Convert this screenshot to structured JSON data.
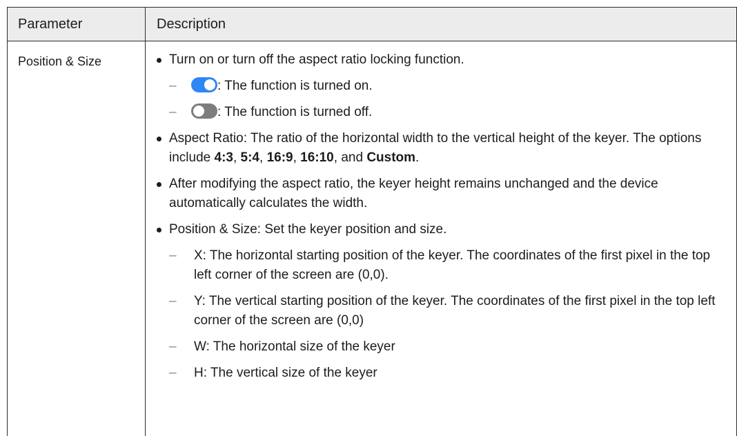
{
  "header": {
    "parameter": "Parameter",
    "description": "Description"
  },
  "row": {
    "parameter": "Position & Size",
    "bullet1": "Turn on or turn off the aspect ratio locking function.",
    "toggle_on_text": ": The function is turned on.",
    "toggle_off_text": ": The function is turned off.",
    "bullet2_prefix": "Aspect Ratio: The ratio of the horizontal width to the vertical height of the keyer. The options include ",
    "ratio_options": [
      "4:3",
      "5:4",
      "16:9",
      "16:10",
      "Custom"
    ],
    "sep_comma": ", ",
    "sep_and": ", and ",
    "period": ".",
    "bullet3": "After modifying the aspect ratio, the keyer height remains unchanged and the device automatically calculates the width.",
    "bullet4": "Position & Size: Set the keyer position and size.",
    "dash": "–",
    "sub_x": "X: The horizontal starting position of the keyer. The coordinates of the first pixel in the top left corner of the screen are (0,0).",
    "sub_y": "Y: The vertical starting position of the keyer. The coordinates of the first pixel in the top left corner of the screen are (0,0)",
    "sub_w": "W: The horizontal size of the keyer",
    "sub_h": "H: The vertical size of the keyer"
  },
  "colors": {
    "toggle_on": "#2f86f6",
    "toggle_off": "#7d7d7d",
    "header_bg": "#ececec"
  },
  "icons": {
    "toggle_on": "toggle-on-icon",
    "toggle_off": "toggle-off-icon"
  }
}
